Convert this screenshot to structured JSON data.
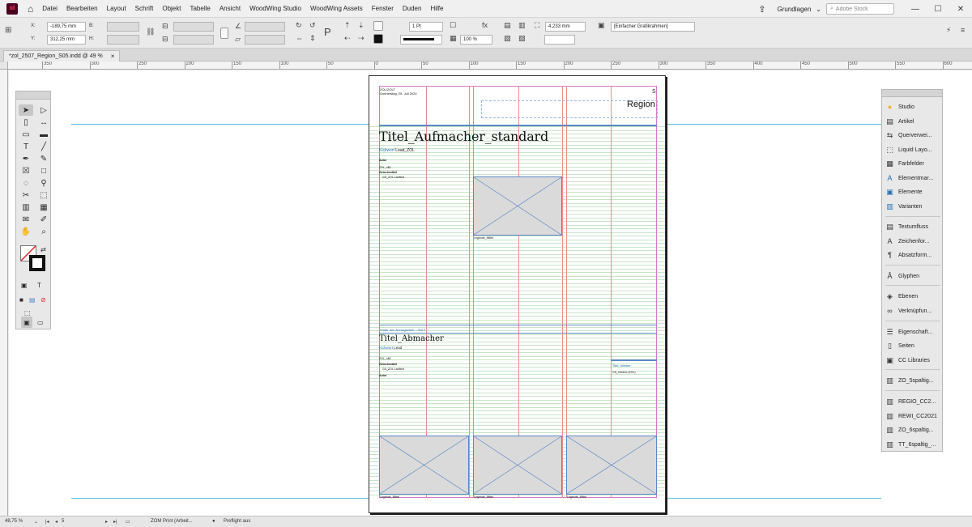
{
  "app": {
    "logo_text": "Id",
    "menus": [
      "Datei",
      "Bearbeiten",
      "Layout",
      "Schrift",
      "Objekt",
      "Tabelle",
      "Ansicht",
      "WoodWing Studio",
      "WoodWing Assets",
      "Fenster",
      "Duden",
      "Hilfe"
    ],
    "workspace": "Grundlagen",
    "stock_search_placeholder": "Adobe Stock"
  },
  "control_panel": {
    "x_label": "X:",
    "x_value": "-189,75 mm",
    "y_label": "Y:",
    "y_value": "312,25 mm",
    "b_label": "B:",
    "h_label": "H:",
    "stroke_weight": "1 Pt",
    "opacity": "100 %",
    "dimension": "4,233 mm",
    "object_style": "[Einfacher Grafikrahmen]"
  },
  "document_tab": {
    "title": "*zol_2507_Region_S05.indd @ 49 %"
  },
  "ruler": {
    "labels": [
      "350",
      "300",
      "250",
      "200",
      "150",
      "100",
      "50",
      "0",
      "50",
      "100",
      "150",
      "200",
      "250",
      "300",
      "350",
      "400",
      "450",
      "500",
      "550",
      "600"
    ]
  },
  "page": {
    "date_line_1": "ZOL/ZOLT",
    "date_line_2": "Donnerstag, 25. Juli 2024",
    "page_number_label": "S",
    "section_title": "Region",
    "headline_1": "Titel_Aufmacher_standard",
    "kicker_1": "Kickwort",
    "lead_1": "Lead_ZOL",
    "author_1": "Autor",
    "body_1a": "ZOL_nB1",
    "body_1b": "Zwischentitel",
    "body_1c": "GS_ZOL Lauftext",
    "caption_mid": "Legende_Mittel",
    "rule_label": "Hinter den Schlagzeilen – Teil 2",
    "headline_2": "Titel_Abmacher",
    "kicker_2": "Kickwort",
    "lead_2": "Lead",
    "body_2a": "ZOL_nB1",
    "body_2b": "Zwischentitel",
    "body_2c": "GS_ZOL Lauftext",
    "author_2": "Autor",
    "side_title": "Titel_Inlieker",
    "side_body": "GS_Infobox (ZOL)",
    "caption_bottom_1": "Legende_Mittel",
    "caption_bottom_2": "Legende_Mittel",
    "caption_bottom_3": "Legende_Mittel"
  },
  "right_panel": {
    "items": [
      {
        "label": "Studio",
        "icon": "studio-icon"
      },
      {
        "label": "Artikel",
        "icon": "article-icon"
      },
      {
        "label": "Querverwei...",
        "icon": "crossref-icon"
      },
      {
        "label": "Liquid Layo...",
        "icon": "liquid-layout-icon"
      },
      {
        "label": "Farbfelder",
        "icon": "swatches-icon"
      },
      {
        "label": "Elementmar...",
        "icon": "element-label-icon"
      },
      {
        "label": "Elemente",
        "icon": "elements-icon"
      },
      {
        "label": "Varianten",
        "icon": "variants-icon"
      },
      {
        "label": "Textumfluss",
        "icon": "text-wrap-icon"
      },
      {
        "label": "Zeichenfor...",
        "icon": "char-styles-icon"
      },
      {
        "label": "Absatzform...",
        "icon": "para-styles-icon"
      },
      {
        "label": "Glyphen",
        "icon": "glyphs-icon"
      },
      {
        "label": "Ebenen",
        "icon": "layers-icon"
      },
      {
        "label": "Verknüpfun...",
        "icon": "links-icon"
      },
      {
        "label": "Eigenschaft...",
        "icon": "properties-icon"
      },
      {
        "label": "Seiten",
        "icon": "pages-icon"
      },
      {
        "label": "CC Libraries",
        "icon": "cc-libraries-icon"
      },
      {
        "label": "ZO_5spaltig...",
        "icon": "library-icon"
      },
      {
        "label": "REGIO_CC2...",
        "icon": "library-icon"
      },
      {
        "label": "REWI_CC2021",
        "icon": "library-icon"
      },
      {
        "label": "ZO_6spaltig...",
        "icon": "library-icon"
      },
      {
        "label": "TT_6spaltig_...",
        "icon": "library-icon"
      }
    ]
  },
  "status": {
    "zoom": "48,75 %",
    "page": "5",
    "profile": "ZOM Print (Arbeit...",
    "preflight": "Preflight aus"
  },
  "colors": {
    "accent": "#ff3366",
    "guide": "#5fc1d4",
    "column_guide": "#ec8d8d",
    "frame": "#5b87c6",
    "baseline": "#c9e3c9"
  }
}
